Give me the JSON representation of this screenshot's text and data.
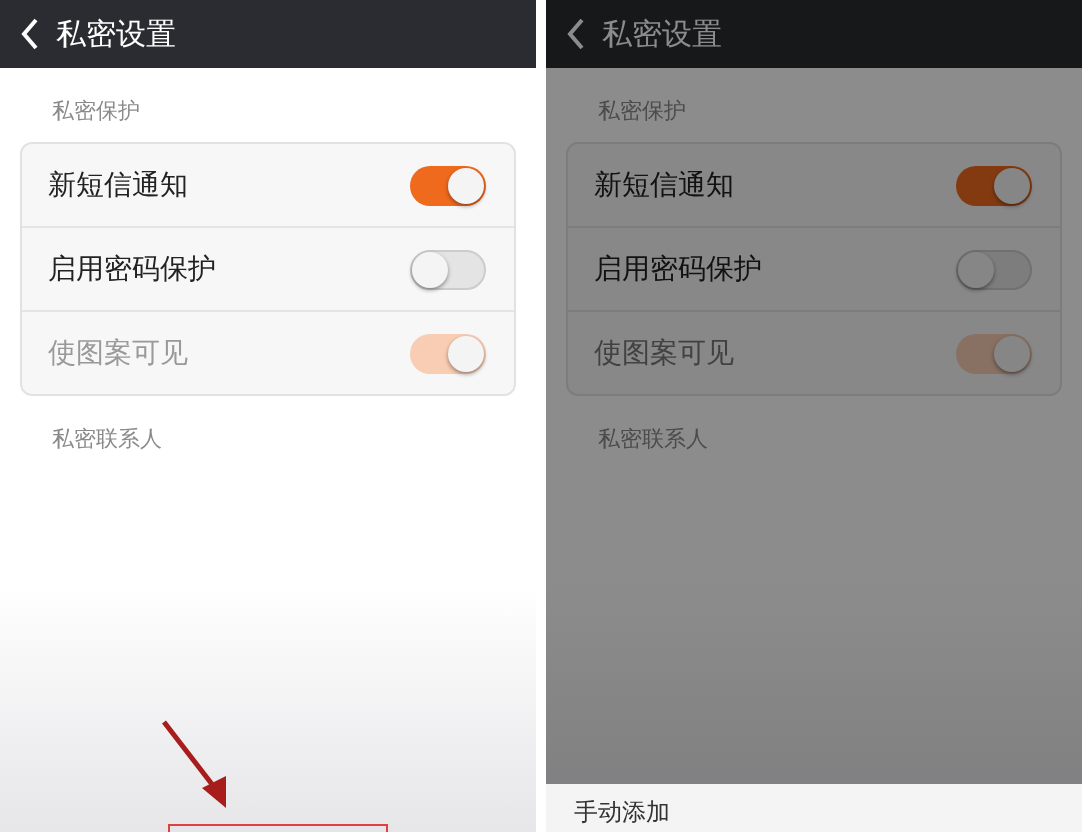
{
  "screens": [
    {
      "title": "私密设置",
      "dimmed": false,
      "section_label": "私密保护",
      "toggles": [
        {
          "label": "新短信通知",
          "on": true,
          "disabled": false
        },
        {
          "label": "启用密码保护",
          "on": false,
          "disabled": false
        },
        {
          "label": "使图案可见",
          "on": true,
          "disabled": true
        }
      ],
      "contacts_label": "私密联系人"
    },
    {
      "title": "私密设置",
      "dimmed": true,
      "section_label": "私密保护",
      "toggles": [
        {
          "label": "新短信通知",
          "on": true,
          "disabled": false
        },
        {
          "label": "启用密码保护",
          "on": false,
          "disabled": false
        },
        {
          "label": "使图案可见",
          "on": true,
          "disabled": true
        }
      ],
      "contacts_label": "私密联系人",
      "bottom_sheet": {
        "items": [
          "手动添加"
        ]
      }
    }
  ]
}
